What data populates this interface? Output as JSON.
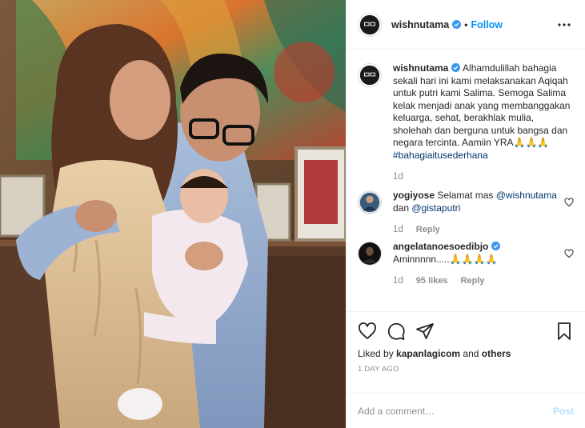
{
  "header": {
    "username": "wishnutama",
    "separator": "•",
    "follow_label": "Follow"
  },
  "caption": {
    "username": "wishnutama",
    "text": "Alhamdulillah bahagia sekali hari ini kami melaksanakan Aqiqah untuk putri kami Salima. Semoga Salima kelak menjadi anak yang membanggakan keluarga, sehat, berakhlak mulia, sholehah dan berguna untuk bangsa dan negara tercinta. Aamiin YRA🙏🙏🙏",
    "hashtag": "#bahagiaitusederhana",
    "time": "1d"
  },
  "comments": [
    {
      "username": "yogiyose",
      "text_before": "Selamat mas",
      "mention1": "@wishnutama",
      "joiner": "dan",
      "mention2": "@gistaputri",
      "time": "1d",
      "reply_label": "Reply"
    },
    {
      "username": "angelatanoesoedibjo",
      "text": "Aminnnnn.....🙏🙏🙏🙏",
      "time": "1d",
      "likes": "95 likes",
      "reply_label": "Reply"
    }
  ],
  "likes": {
    "prefix": "Liked by",
    "user": "kapanlagicom",
    "suffix": "and",
    "others": "others"
  },
  "timestamp": "1 DAY AGO",
  "comment_box": {
    "placeholder": "Add a comment…",
    "post_label": "Post"
  },
  "colors": {
    "link_blue": "#0095f6",
    "mention": "#00376b",
    "muted": "#8e8e8e",
    "post_disabled": "#b2dffc",
    "verified": "#3897f0"
  }
}
